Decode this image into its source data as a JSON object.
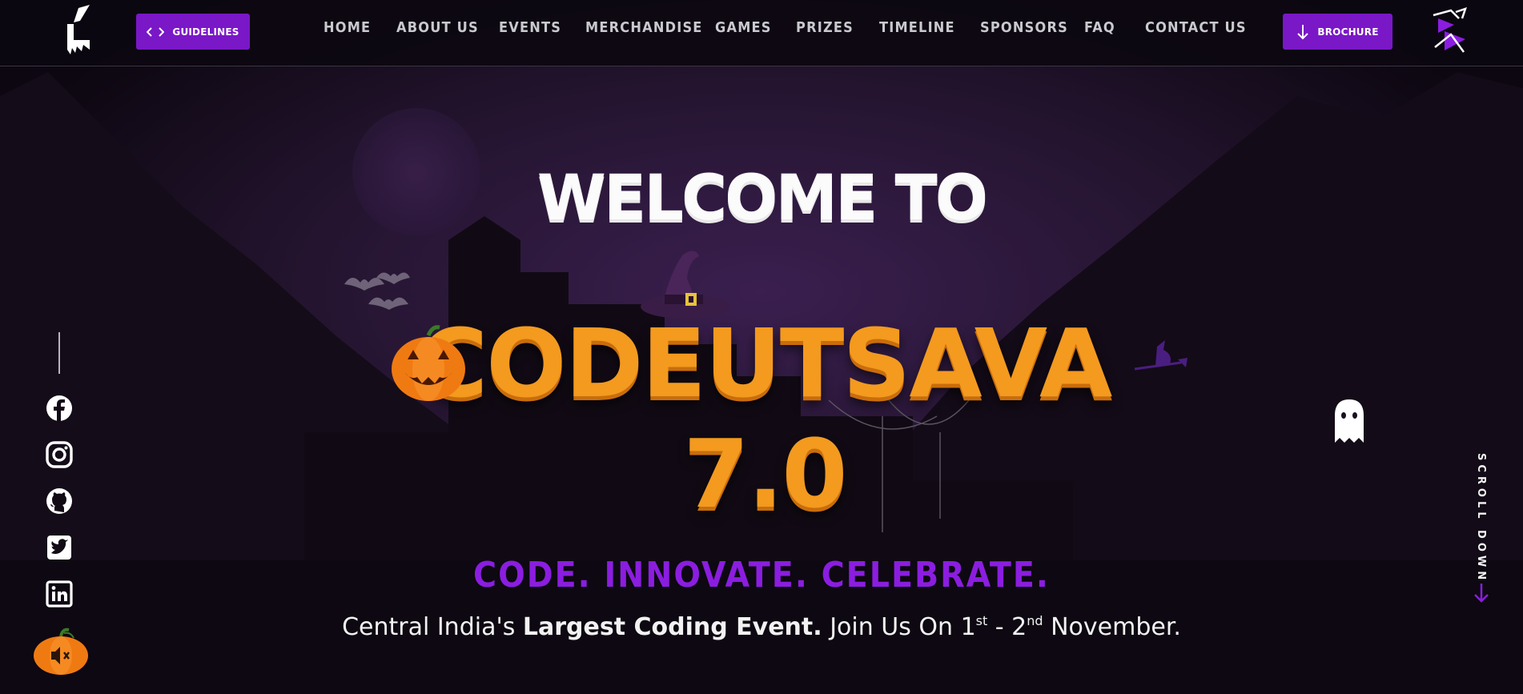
{
  "nav": {
    "guidelines_label": "GUIDELINES",
    "brochure_label": "BROCHURE",
    "links": [
      "HOME",
      "ABOUT US",
      "EVENTS",
      "MERCHANDISE",
      "GAMES",
      "PRIZES",
      "TIMELINE",
      "SPONSORS",
      "FAQ",
      "CONTACT US"
    ]
  },
  "hero": {
    "welcome": "WELCOME TO",
    "title": "CODEUTSAVA 7.0",
    "tagline": "CODE. INNOVATE. CELEBRATE.",
    "sub_prefix": "Central India's ",
    "sub_bold": "Largest Coding Event.",
    "sub_mid": " Join Us On 1",
    "sub_sup1": "st",
    "sub_dash": " - 2",
    "sub_sup2": "nd",
    "sub_suffix": " November."
  },
  "socials": [
    "facebook-icon",
    "instagram-icon",
    "github-icon",
    "twitter-icon",
    "linkedin-icon"
  ],
  "scroll": {
    "label": "SCROLL DOWN"
  },
  "colors": {
    "accent_purple": "#7a17c7",
    "tagline_purple": "#8b1de0",
    "title_orange": "#f39a1f",
    "background": "#0d0812"
  }
}
